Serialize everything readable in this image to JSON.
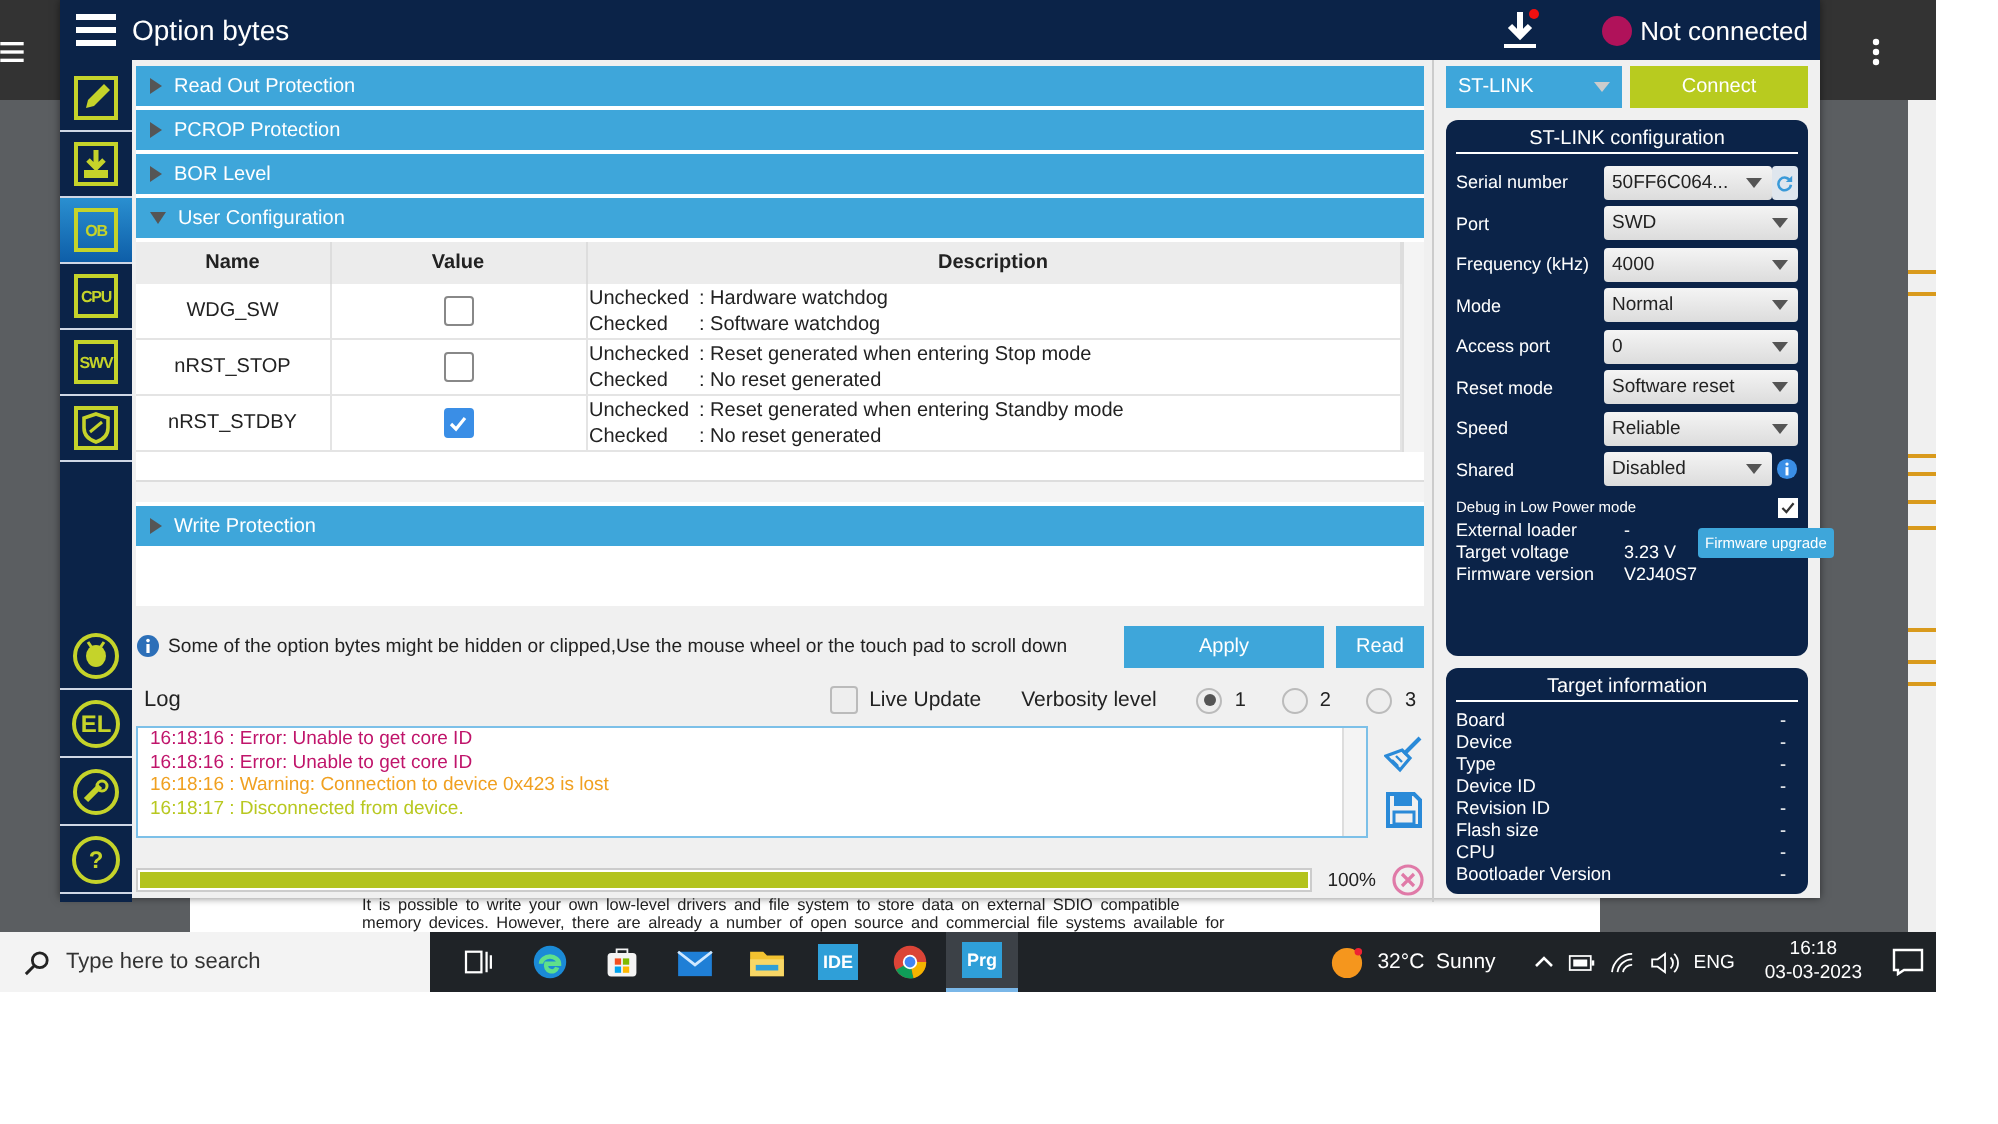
{
  "background_page": {
    "document_lines": [
      "It is possible to write your own low-level drivers and file system to store data on external SDIO compatible",
      "memory devices. However, there are already a number of open source and commercial file systems available for"
    ]
  },
  "app_window": {
    "title": "Option bytes",
    "connection_status": "Not connected",
    "sidebar_top": [
      {
        "kind": "pencil",
        "selected": false
      },
      {
        "kind": "download",
        "selected": false
      },
      {
        "kind": "text",
        "label": "OB",
        "selected": true
      },
      {
        "kind": "text",
        "label": "CPU",
        "selected": false
      },
      {
        "kind": "text",
        "label": "SWV",
        "selected": false
      },
      {
        "kind": "shield",
        "selected": false
      }
    ],
    "sidebar_bottom": [
      {
        "kind": "bug",
        "selected": false
      },
      {
        "kind": "text",
        "label": "EL",
        "selected": false
      },
      {
        "kind": "key",
        "selected": false
      },
      {
        "kind": "text",
        "label": "?",
        "selected": false
      }
    ],
    "sections": [
      {
        "title": "Read Out Protection",
        "expanded": false
      },
      {
        "title": "PCROP Protection",
        "expanded": false
      },
      {
        "title": "BOR Level",
        "expanded": false
      },
      {
        "title": "User Configuration",
        "expanded": true
      },
      {
        "title": "Write Protection",
        "expanded": false
      }
    ],
    "table": {
      "columns": [
        "Name",
        "Value",
        "Description"
      ],
      "rows": [
        {
          "name": "WDG_SW",
          "checked": false,
          "description": [
            {
              "state": "Unchecked",
              "text": ": Hardware watchdog"
            },
            {
              "state": "Checked",
              "text": ": Software watchdog"
            }
          ]
        },
        {
          "name": "nRST_STOP",
          "checked": false,
          "description": [
            {
              "state": "Unchecked",
              "text": ": Reset generated when entering Stop mode"
            },
            {
              "state": "Checked",
              "text": ": No reset generated"
            }
          ]
        },
        {
          "name": "nRST_STDBY",
          "checked": true,
          "description": [
            {
              "state": "Unchecked",
              "text": ": Reset generated when entering Standby mode"
            },
            {
              "state": "Checked",
              "text": ": No reset generated"
            }
          ]
        }
      ]
    },
    "note": "Some of the option bytes might be hidden or clipped,Use the mouse wheel or the touch pad to scroll down",
    "buttons": [
      "Apply",
      "Read"
    ],
    "log": {
      "title": "Log",
      "live_update": {
        "label": "Live Update",
        "checked": false
      },
      "verbosity_label": "Verbosity level",
      "verbosity": [
        {
          "label": "1",
          "selected": true
        },
        {
          "label": "2",
          "selected": false
        },
        {
          "label": "3",
          "selected": false
        }
      ],
      "entries": [
        {
          "text": "16:18:16 : Error: Unable to get core ID",
          "color": "#c0156b"
        },
        {
          "text": "16:18:16 : Error: Unable to get core ID",
          "color": "#c0156b"
        },
        {
          "text": "16:18:16 : Warning: Connection to device 0x423 is lost",
          "color": "#f0a020"
        },
        {
          "text": "16:18:17 : Disconnected from device.",
          "color": "#b8c820"
        }
      ]
    },
    "progress": {
      "level": 1,
      "reading": "100%"
    },
    "interface": "ST-LINK",
    "connect_button": "Connect",
    "config": {
      "title": "ST-LINK configuration",
      "fields": [
        {
          "label": "Serial number",
          "value": "50FF6C064...",
          "kind": "refresh"
        },
        {
          "label": "Port",
          "value": "SWD",
          "kind": "select"
        },
        {
          "label": "Frequency (kHz)",
          "value": "4000",
          "kind": "select"
        },
        {
          "label": "Mode",
          "value": "Normal",
          "kind": "select"
        },
        {
          "label": "Access port",
          "value": "0",
          "kind": "select"
        },
        {
          "label": "Reset mode",
          "value": "Software reset",
          "kind": "select"
        },
        {
          "label": "Speed",
          "value": "Reliable",
          "kind": "select"
        },
        {
          "label": "Shared",
          "value": "Disabled",
          "kind": "info"
        }
      ],
      "debug_low_power": {
        "label": "Debug in Low Power mode",
        "checked": true
      },
      "details": [
        {
          "label": "External loader",
          "value": "-"
        },
        {
          "label": "Target voltage",
          "value": "3.23 V"
        },
        {
          "label": "Firmware version",
          "value": "V2J40S7"
        }
      ],
      "firmware_button": "Firmware upgrade"
    },
    "target_info": {
      "title": "Target information",
      "rows": [
        {
          "label": "Board",
          "value": "-"
        },
        {
          "label": "Device",
          "value": "-"
        },
        {
          "label": "Type",
          "value": "-"
        },
        {
          "label": "Device ID",
          "value": "-"
        },
        {
          "label": "Revision ID",
          "value": "-"
        },
        {
          "label": "Flash size",
          "value": "-"
        },
        {
          "label": "CPU",
          "value": "-"
        },
        {
          "label": "Bootloader Version",
          "value": "-"
        }
      ]
    }
  },
  "taskbar": {
    "search_placeholder": "Type here to search",
    "apps": [
      {
        "kind": "taskview",
        "selected": false
      },
      {
        "kind": "edge",
        "selected": false
      },
      {
        "kind": "store",
        "selected": false
      },
      {
        "kind": "mail",
        "selected": false
      },
      {
        "kind": "folder",
        "selected": false
      },
      {
        "kind": "text",
        "label": "IDE",
        "selected": false
      },
      {
        "kind": "chrome",
        "selected": false
      },
      {
        "kind": "text",
        "label": "Prg",
        "selected": true
      }
    ],
    "weather": "32°C  Sunny",
    "language": "ENG",
    "time": "16:18",
    "date": "03-03-2023"
  }
}
